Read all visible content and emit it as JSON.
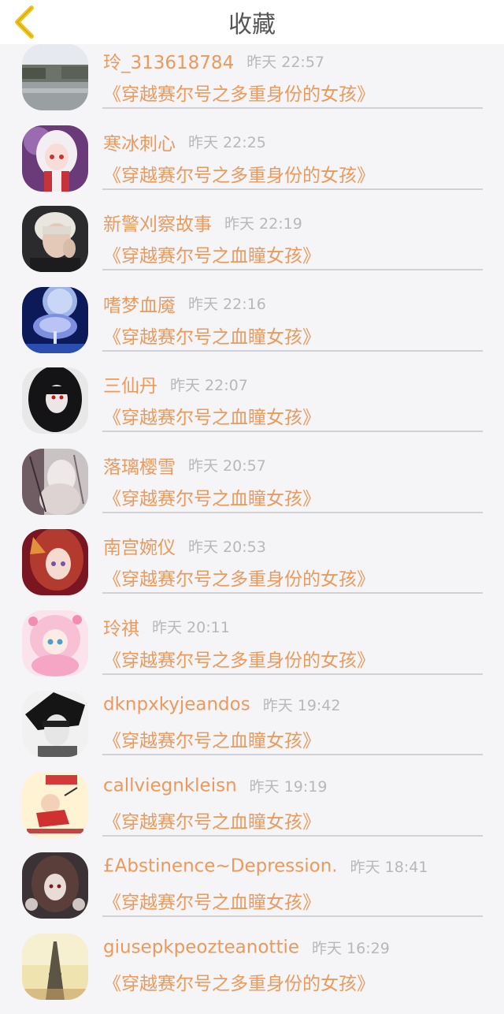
{
  "header": {
    "title": "收藏"
  },
  "items": [
    {
      "name": "玲_313618784",
      "time": "昨天 22:57",
      "book": "《穿越赛尔号之多重身份的女孩》"
    },
    {
      "name": "寒冰刺心",
      "time": "昨天 22:25",
      "book": "《穿越赛尔号之多重身份的女孩》"
    },
    {
      "name": "新警刈察故事",
      "time": "昨天 22:19",
      "book": "《穿越赛尔号之血瞳女孩》"
    },
    {
      "name": "嗜梦血魇",
      "time": "昨天 22:16",
      "book": "《穿越赛尔号之血瞳女孩》"
    },
    {
      "name": "三仙丹",
      "time": "昨天 22:07",
      "book": "《穿越赛尔号之血瞳女孩》"
    },
    {
      "name": "落璃樱雪",
      "time": "昨天 20:57",
      "book": "《穿越赛尔号之血瞳女孩》"
    },
    {
      "name": "南宫婉仪",
      "time": "昨天 20:53",
      "book": "《穿越赛尔号之多重身份的女孩》"
    },
    {
      "name": "玲祺",
      "time": "昨天 20:11",
      "book": "《穿越赛尔号之多重身份的女孩》"
    },
    {
      "name": "dknpxkyjeandos",
      "time": "昨天 19:42",
      "book": "《穿越赛尔号之血瞳女孩》"
    },
    {
      "name": "callviegnkleisn",
      "time": "昨天 19:19",
      "book": "《穿越赛尔号之血瞳女孩》"
    },
    {
      "name": "£Abstinence~Depression.",
      "time": "昨天 18:41",
      "book": "《穿越赛尔号之血瞳女孩》"
    },
    {
      "name": "giusepkpeozteanottie",
      "time": "昨天 16:29",
      "book": "《穿越赛尔号之多重身份的女孩》"
    }
  ],
  "colors": {
    "accent": "#ec9a5c",
    "time": "#b8b8b8",
    "divider": "#d2d2d6",
    "background": "#f5f4f7"
  }
}
